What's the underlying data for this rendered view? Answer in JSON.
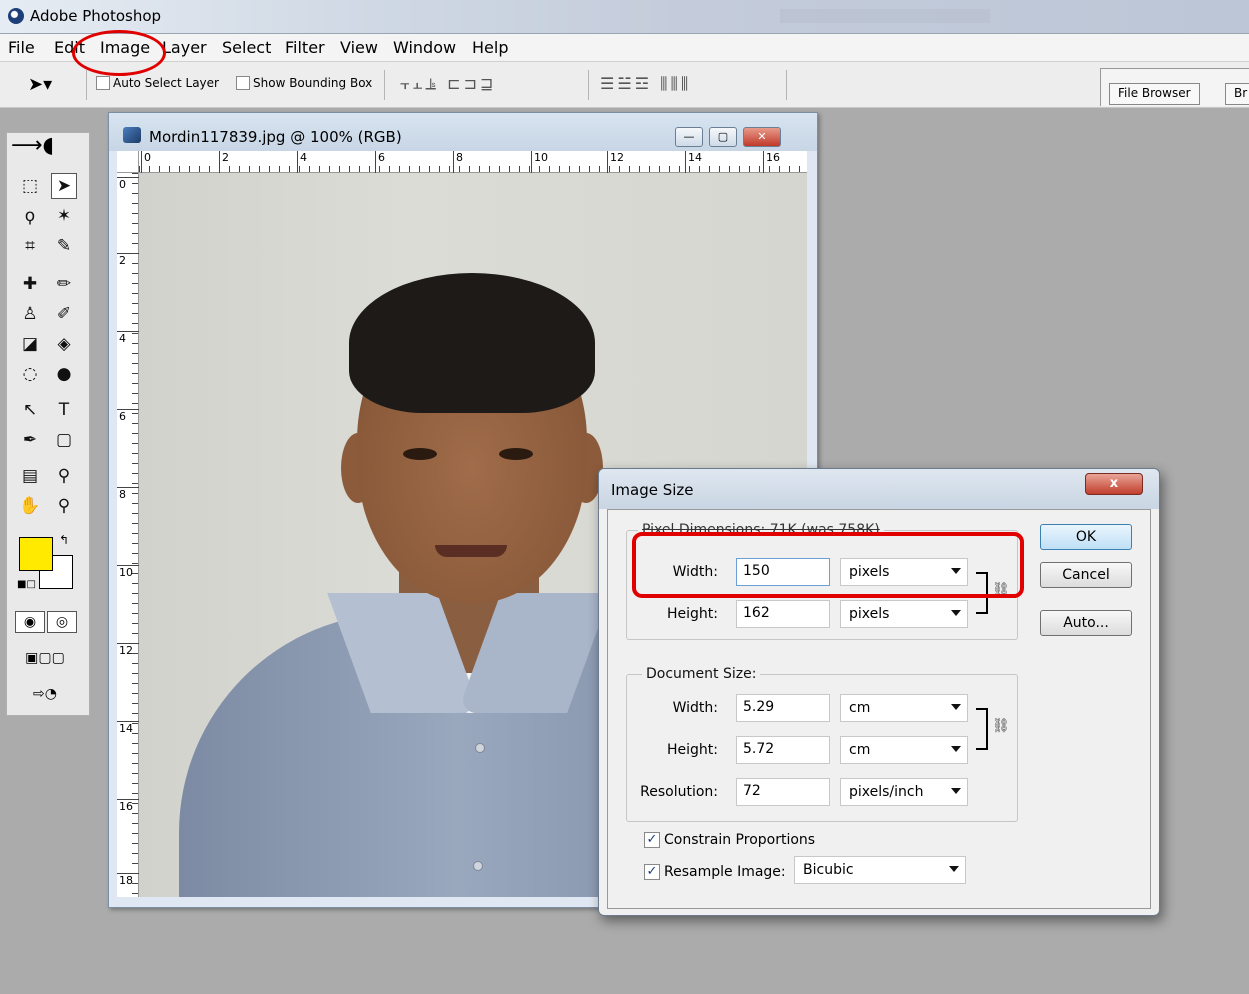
{
  "app": {
    "title": "Adobe Photoshop"
  },
  "menu": [
    "File",
    "Edit",
    "Image",
    "Layer",
    "Select",
    "Filter",
    "View",
    "Window",
    "Help"
  ],
  "options": {
    "auto_select_layer": "Auto Select Layer",
    "show_bounding_box": "Show Bounding Box",
    "file_browser_tab": "File Browser",
    "next_tab": "Br"
  },
  "document": {
    "title": "Mordin117839.jpg @ 100% (RGB)",
    "ruler_h": [
      "0",
      "2",
      "4",
      "6",
      "8",
      "10",
      "12",
      "14",
      "16"
    ],
    "ruler_v": [
      "0",
      "2",
      "4",
      "6",
      "8",
      "10",
      "12",
      "14",
      "16",
      "18"
    ]
  },
  "colors": {
    "foreground": "#ffea00",
    "background": "#ffffff",
    "annotation": "#e00000"
  },
  "dialog": {
    "title": "Image Size",
    "close": "x",
    "pixel_dimensions_label": "Pixel Dimensions: 71K (was 758K)",
    "px_width_label": "Width:",
    "px_width_value": "150",
    "px_width_unit": "pixels",
    "px_height_label": "Height:",
    "px_height_value": "162",
    "px_height_unit": "pixels",
    "document_size_label": "Document Size:",
    "doc_width_label": "Width:",
    "doc_width_value": "5.29",
    "doc_width_unit": "cm",
    "doc_height_label": "Height:",
    "doc_height_value": "5.72",
    "doc_height_unit": "cm",
    "resolution_label": "Resolution:",
    "resolution_value": "72",
    "resolution_unit": "pixels/inch",
    "constrain": "Constrain Proportions",
    "resample": "Resample Image:",
    "resample_method": "Bicubic",
    "ok": "OK",
    "cancel": "Cancel",
    "auto": "Auto..."
  }
}
